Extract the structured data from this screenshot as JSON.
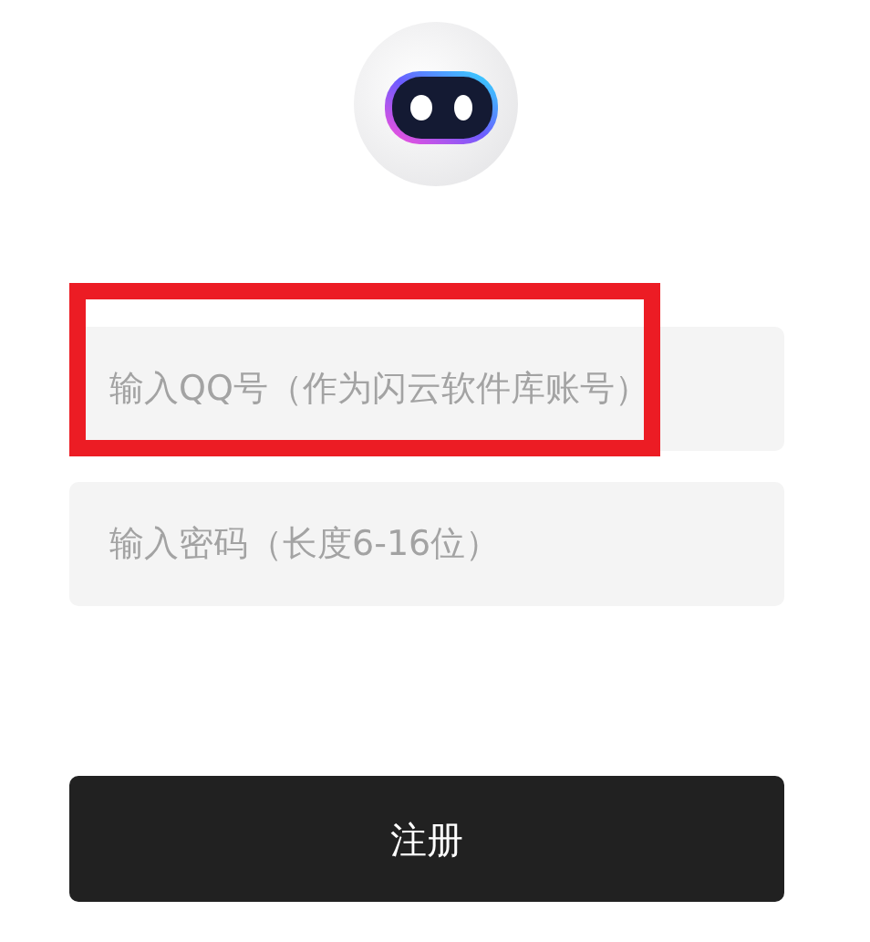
{
  "fields": [
    {
      "placeholder": "输入QQ号（作为闪云软件库账号）",
      "highlighted": true
    },
    {
      "placeholder": "输入密码（长度6-16位）",
      "highlighted": false
    }
  ],
  "submit_button": {
    "label": "注册"
  }
}
